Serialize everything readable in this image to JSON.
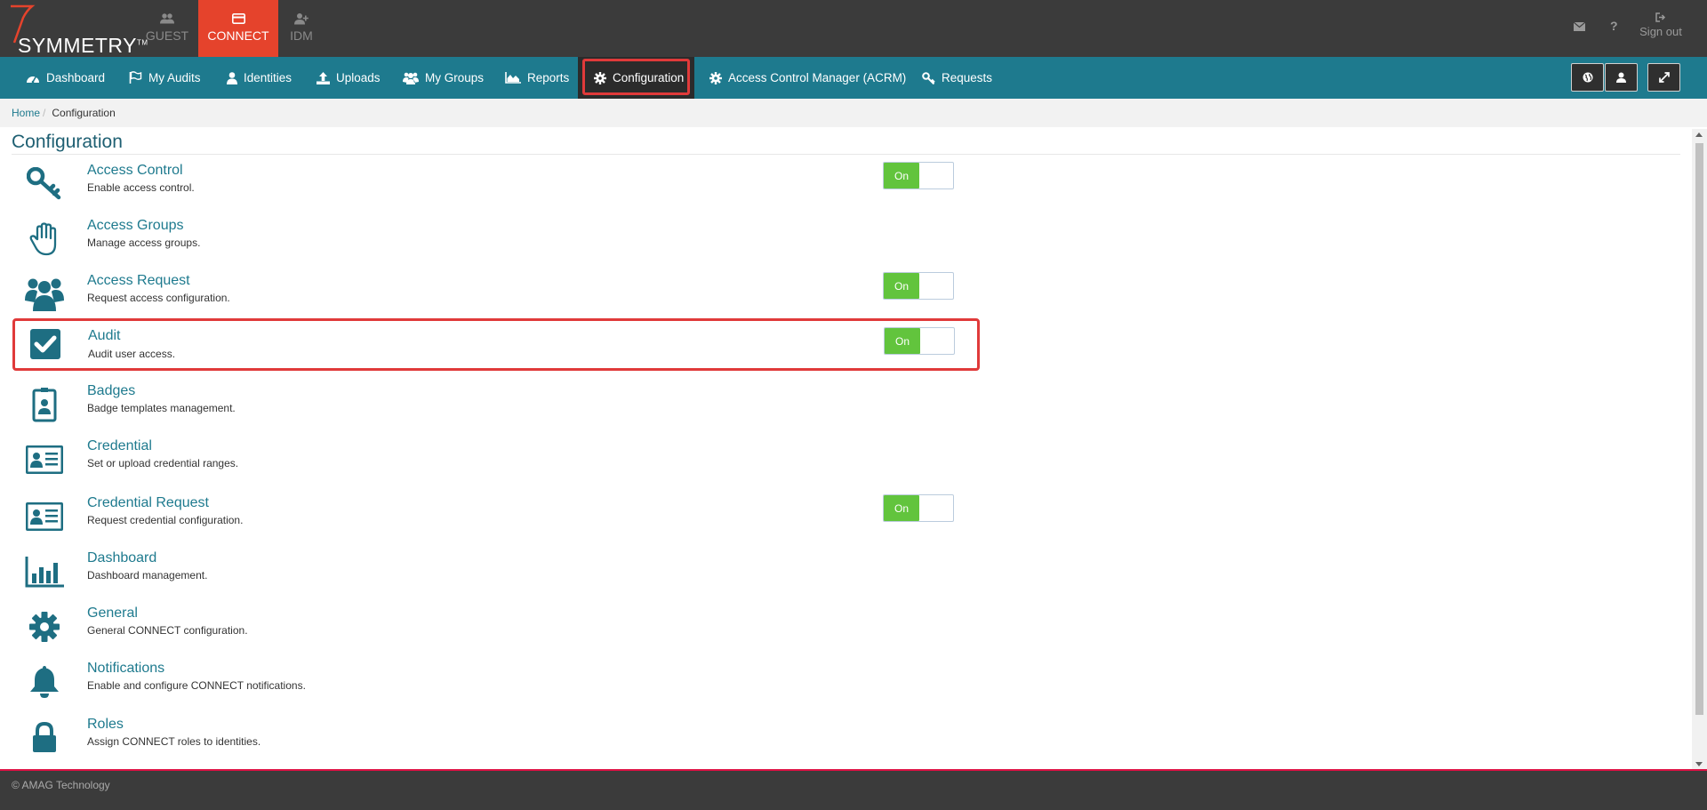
{
  "brand": {
    "logo_text": "SYMMETRY",
    "tm": "TM",
    "logo_color": "#e5432c"
  },
  "app_tabs": [
    {
      "label": "GUEST",
      "icon": "guest-group-icon"
    },
    {
      "label": "CONNECT",
      "icon": "card-icon",
      "active": true
    },
    {
      "label": "IDM",
      "icon": "user-add-icon"
    }
  ],
  "top_actions": {
    "mail_icon": "envelope-icon",
    "help": "?",
    "signout": "Sign out"
  },
  "nav": [
    {
      "label": "Dashboard",
      "icon": "dashboard-icon"
    },
    {
      "label": "My Audits",
      "icon": "flag-icon"
    },
    {
      "label": "Identities",
      "icon": "person-icon"
    },
    {
      "label": "Uploads",
      "icon": "upload-icon"
    },
    {
      "label": "My Groups",
      "icon": "group-icon"
    },
    {
      "label": "Reports",
      "icon": "area-chart-icon"
    },
    {
      "label": "Configuration",
      "icon": "gear-icon",
      "active": true
    },
    {
      "label": "Access Control Manager (ACRM)",
      "icon": "gear-icon"
    },
    {
      "label": "Requests",
      "icon": "key-icon"
    }
  ],
  "breadcrumb": {
    "home": "Home",
    "sep": "/",
    "current": "Configuration"
  },
  "page_title": "Configuration",
  "items": [
    {
      "title": "Access Control",
      "desc": "Enable access control.",
      "icon": "key-icon",
      "toggle": "On"
    },
    {
      "title": "Access Groups",
      "desc": "Manage access groups.",
      "icon": "hand-icon"
    },
    {
      "title": "Access Request",
      "desc": "Request access configuration.",
      "icon": "users-icon",
      "toggle": "On"
    },
    {
      "title": "Audit",
      "desc": "Audit user access.",
      "icon": "checkbox-icon",
      "toggle": "On",
      "highlighted": true
    },
    {
      "title": "Badges",
      "desc": "Badge templates management.",
      "icon": "badge-icon"
    },
    {
      "title": "Credential",
      "desc": "Set or upload credential ranges.",
      "icon": "id-card-icon"
    },
    {
      "title": "Credential Request",
      "desc": "Request credential configuration.",
      "icon": "id-card-icon",
      "toggle": "On"
    },
    {
      "title": "Dashboard",
      "desc": "Dashboard management.",
      "icon": "bar-chart-icon"
    },
    {
      "title": "General",
      "desc": "General CONNECT configuration.",
      "icon": "gear-icon"
    },
    {
      "title": "Notifications",
      "desc": "Enable and configure CONNECT notifications.",
      "icon": "bell-icon"
    },
    {
      "title": "Roles",
      "desc": "Assign CONNECT roles to identities.",
      "icon": "lock-icon"
    }
  ],
  "footer": "© AMAG Technology",
  "colors": {
    "teal": "#1e7a8e",
    "toggle_on": "#62c43d",
    "highlight": "#e03a3a",
    "topbar": "#3b3b3b"
  }
}
